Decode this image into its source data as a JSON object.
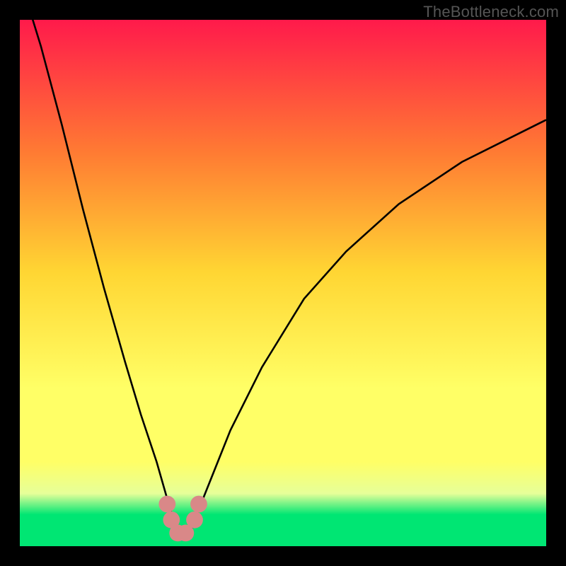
{
  "watermark": "TheBottleneck.com",
  "colors": {
    "gradient_top": "#ff1a4b",
    "gradient_mid_upper": "#ff7a33",
    "gradient_mid": "#ffd633",
    "gradient_lower": "#ffff66",
    "gradient_band": "#e6ff99",
    "gradient_bottom": "#00e673",
    "curve": "#000000",
    "marker": "#d98888",
    "frame": "#000000"
  },
  "chart_data": {
    "type": "line",
    "title": "",
    "xlabel": "",
    "ylabel": "",
    "xlim": [
      0,
      100
    ],
    "ylim": [
      0,
      100
    ],
    "series": [
      {
        "name": "bottleneck-curve",
        "x": [
          0,
          4,
          8,
          12,
          16,
          20,
          23,
          26,
          28,
          29.5,
          30.5,
          32,
          33,
          34,
          36,
          40,
          46,
          54,
          62,
          72,
          84,
          100
        ],
        "values": [
          108,
          95,
          80,
          64,
          49,
          35,
          25,
          16,
          9,
          4,
          2.5,
          2.5,
          4,
          7,
          12,
          22,
          34,
          47,
          56,
          65,
          73,
          81
        ]
      }
    ],
    "markers": [
      {
        "name": "left-top",
        "x": 28.0,
        "y": 8.0
      },
      {
        "name": "left-mid",
        "x": 28.8,
        "y": 5.0
      },
      {
        "name": "bottom-1",
        "x": 30.0,
        "y": 2.5
      },
      {
        "name": "bottom-2",
        "x": 31.5,
        "y": 2.5
      },
      {
        "name": "right-mid",
        "x": 33.2,
        "y": 5.0
      },
      {
        "name": "right-top",
        "x": 34.0,
        "y": 8.0
      }
    ],
    "gradient_stops_pct": [
      0,
      25,
      48,
      70,
      84,
      90,
      94,
      100
    ]
  }
}
